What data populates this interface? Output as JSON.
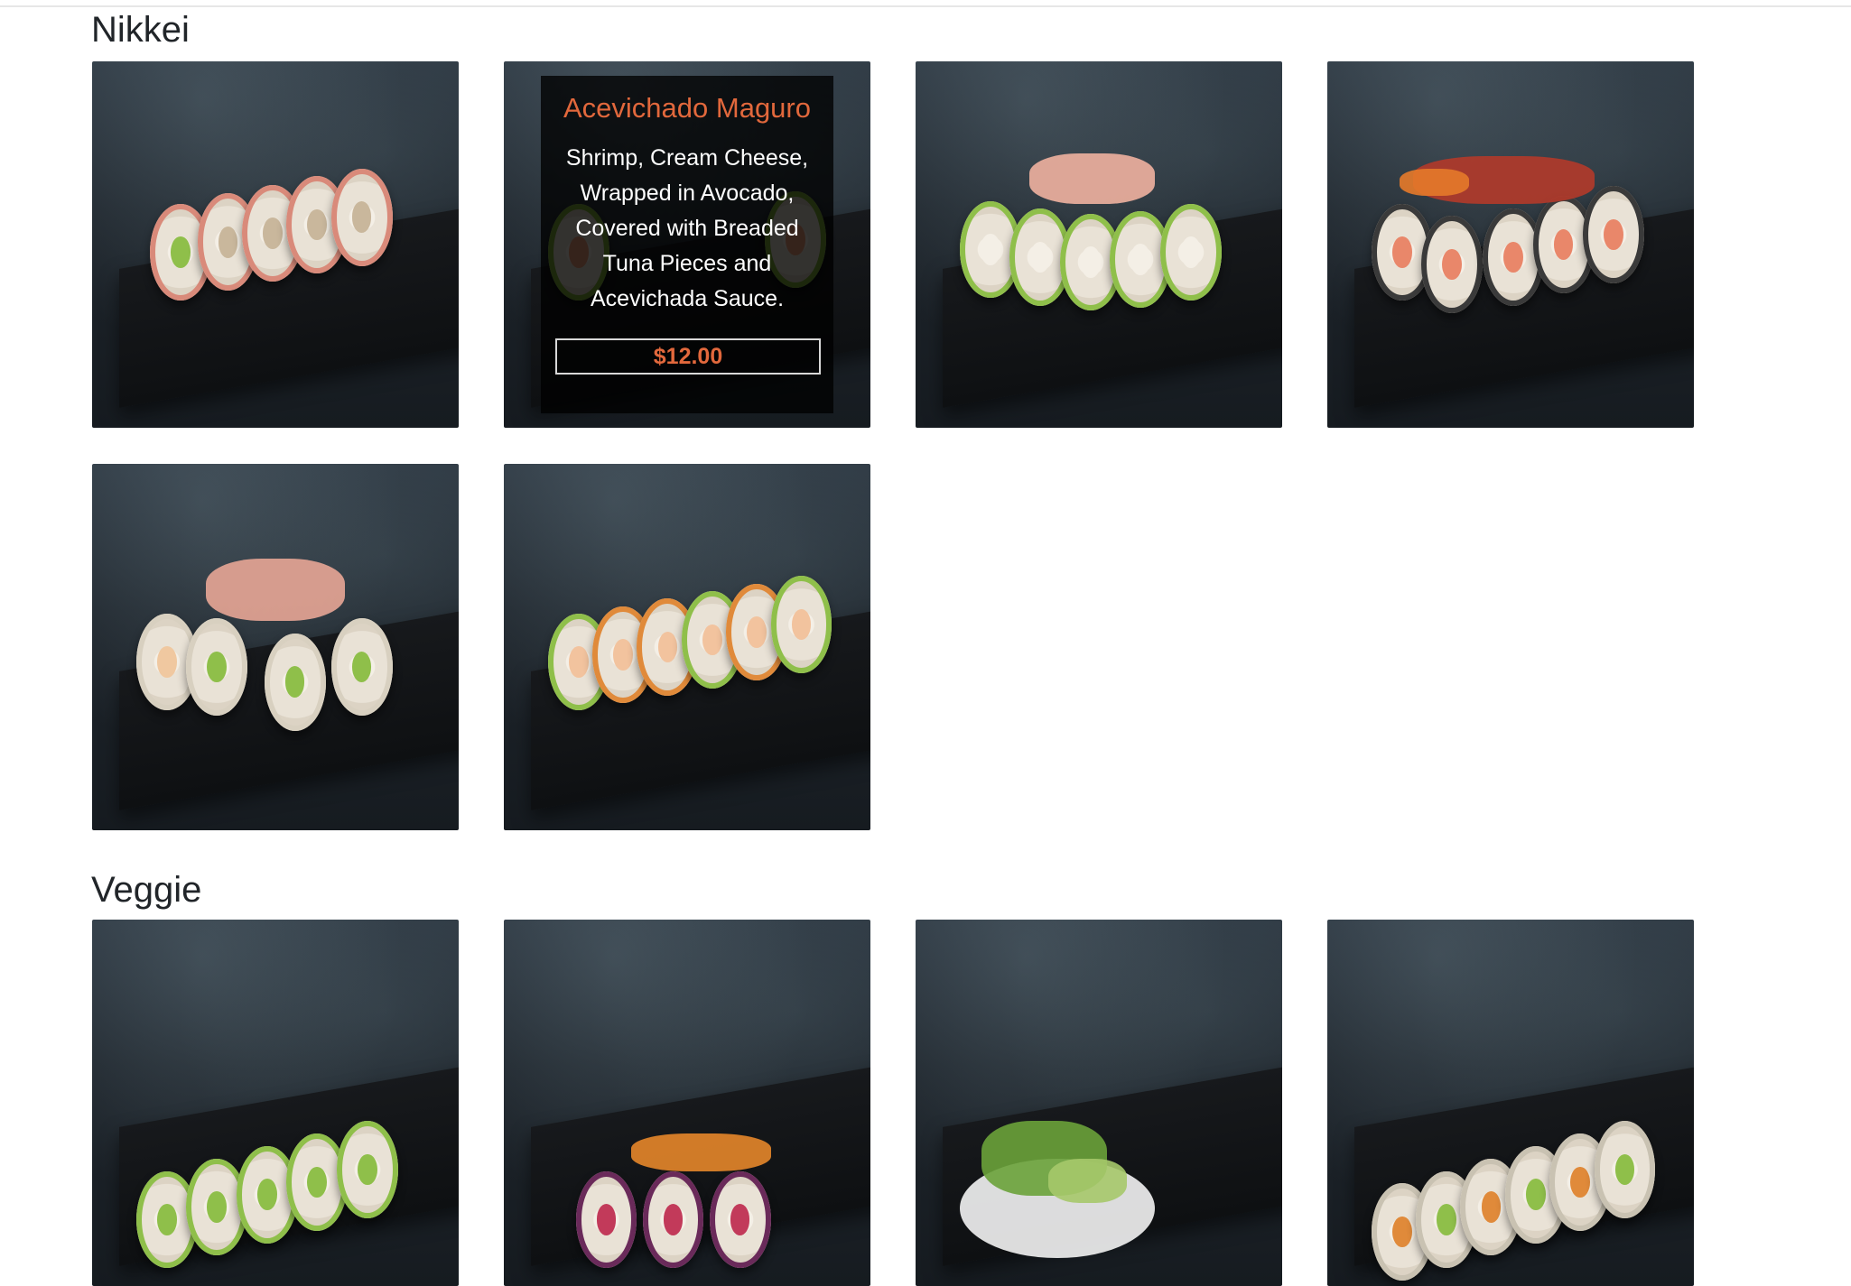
{
  "sections": [
    {
      "title": "Nikkei",
      "items": [
        {
          "image": "sushi-roll-photo"
        },
        {
          "image": "sushi-roll-photo",
          "overlay": {
            "name": "Acevichado Maguro",
            "description": "Shrimp, Cream Cheese, Wrapped in Avocado, Covered with Breaded Tuna Pieces and Acevichada Sauce.",
            "price": "$12.00"
          }
        },
        {
          "image": "sushi-roll-photo"
        },
        {
          "image": "sushi-roll-photo"
        },
        {
          "image": "sushi-roll-photo"
        },
        {
          "image": "sushi-roll-photo"
        }
      ]
    },
    {
      "title": "Veggie",
      "items": [
        {
          "image": "sushi-roll-photo"
        },
        {
          "image": "sushi-roll-photo"
        },
        {
          "image": "salad-bowl-photo"
        },
        {
          "image": "sushi-roll-photo"
        }
      ]
    }
  ],
  "colors": {
    "accent": "#e2683c",
    "tile_background": "#1f262d",
    "heading": "#212529"
  }
}
